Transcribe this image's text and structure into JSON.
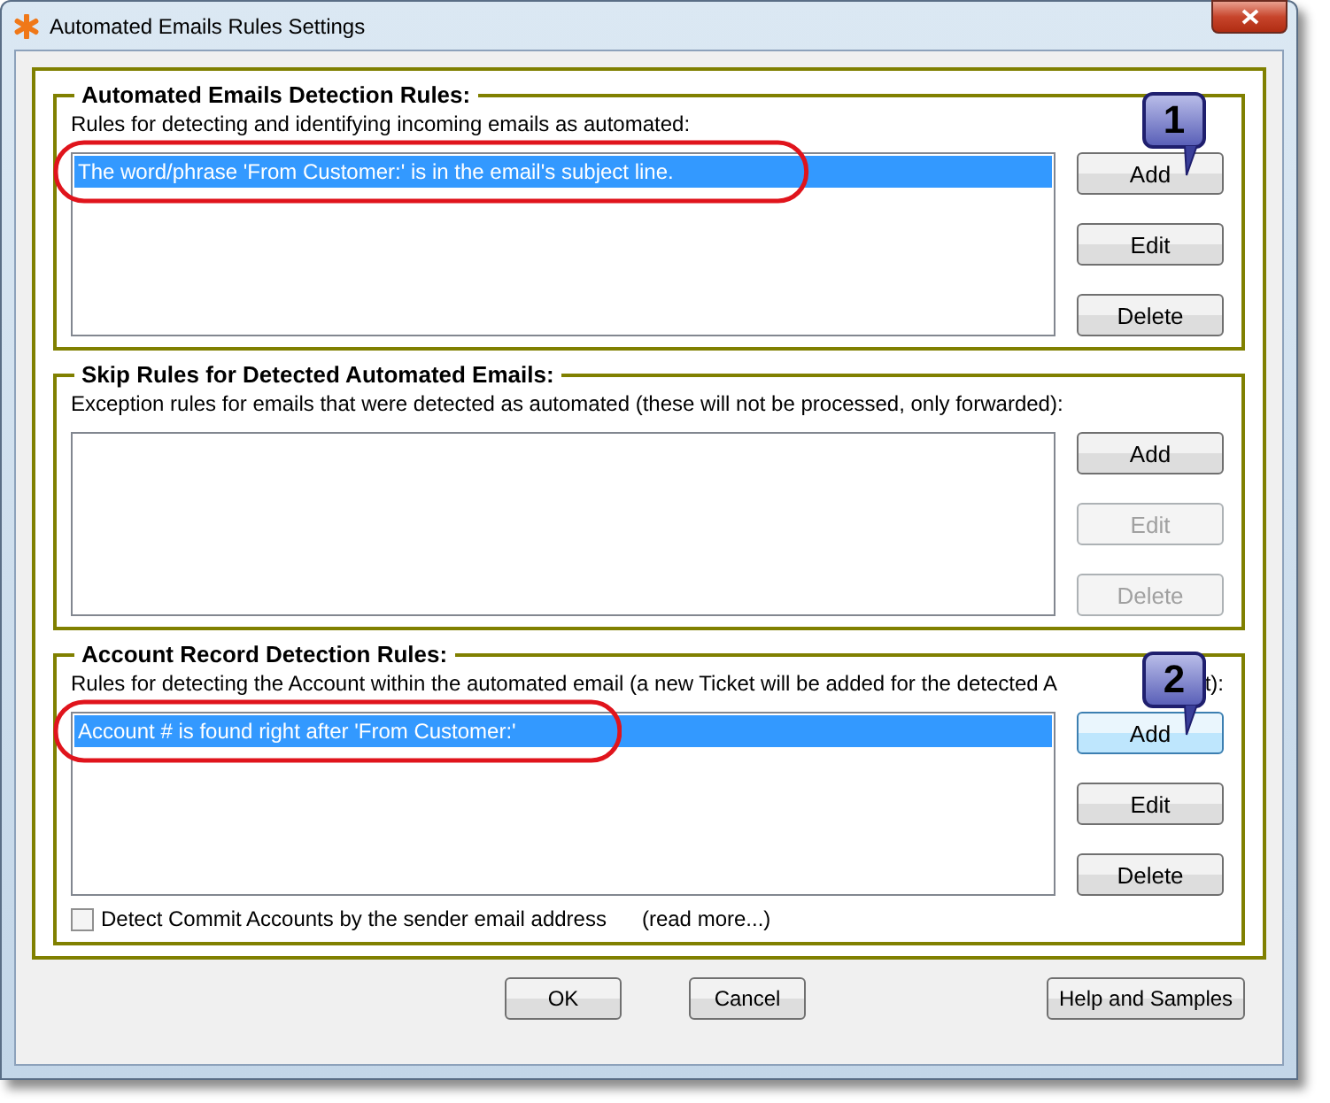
{
  "window": {
    "title": "Automated Emails Rules Settings"
  },
  "groups": [
    {
      "title": "Automated Emails Detection Rules:",
      "description": "Rules for detecting and identifying incoming emails as automated:",
      "rules": [
        {
          "text": "The word/phrase 'From Customer:' is in the email's subject line.",
          "selected": true
        }
      ],
      "buttons": [
        {
          "label": "Add",
          "disabled": false,
          "focused": false
        },
        {
          "label": "Edit",
          "disabled": false,
          "focused": false
        },
        {
          "label": "Delete",
          "disabled": false,
          "focused": false
        }
      ],
      "callout": "1"
    },
    {
      "title": "Skip Rules for Detected Automated Emails:",
      "description": "Exception rules for emails that were detected as automated (these will not be processed, only forwarded):",
      "buttons": [
        {
          "label": "Add",
          "disabled": false,
          "focused": false
        },
        {
          "label": "Edit",
          "disabled": true,
          "focused": false
        },
        {
          "label": "Delete",
          "disabled": true,
          "focused": false
        }
      ]
    },
    {
      "title": "Account Record Detection Rules:",
      "description": "Rules for detecting the Account within the automated email (a new Ticket will be added for the detected A",
      "description_tail": "t):",
      "rules": [
        {
          "text": "Account # is found right after 'From Customer:'",
          "selected": true
        }
      ],
      "buttons": [
        {
          "label": "Add",
          "disabled": false,
          "focused": true
        },
        {
          "label": "Edit",
          "disabled": false,
          "focused": false
        },
        {
          "label": "Delete",
          "disabled": false,
          "focused": false
        }
      ],
      "callout": "2"
    }
  ],
  "checkbox": {
    "label": "Detect Commit Accounts by the sender email address",
    "checked": false
  },
  "link": "(read more...)",
  "footer_buttons": [
    "OK",
    "Cancel",
    "Help and Samples"
  ]
}
